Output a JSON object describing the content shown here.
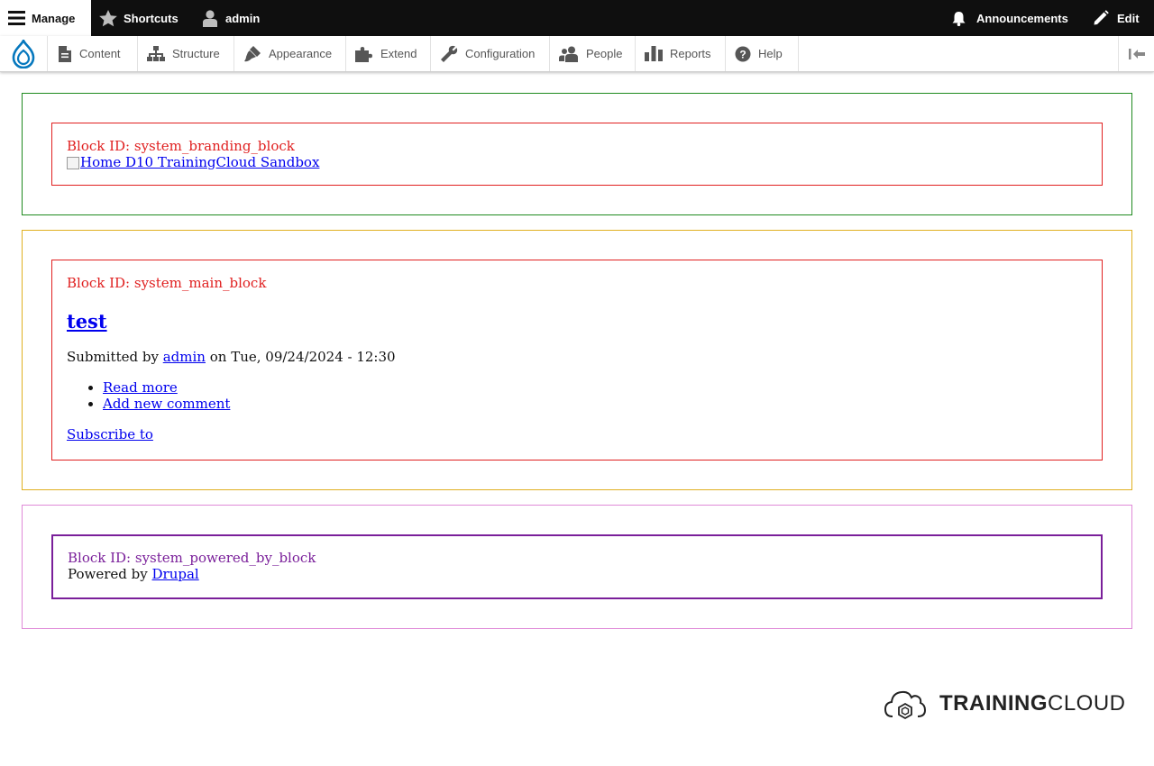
{
  "toolbar": {
    "manage_label": "Manage",
    "shortcuts_label": "Shortcuts",
    "user_label": "admin",
    "announcements_label": "Announcements",
    "edit_label": "Edit"
  },
  "tray": {
    "items": [
      {
        "label": "Content",
        "icon": "file-icon"
      },
      {
        "label": "Structure",
        "icon": "sitemap-icon"
      },
      {
        "label": "Appearance",
        "icon": "paintbrush-icon"
      },
      {
        "label": "Extend",
        "icon": "puzzle-icon"
      },
      {
        "label": "Configuration",
        "icon": "wrench-icon"
      },
      {
        "label": "People",
        "icon": "people-icon"
      },
      {
        "label": "Reports",
        "icon": "bar-chart-icon"
      },
      {
        "label": "Help",
        "icon": "help-icon"
      }
    ]
  },
  "colors": {
    "toolbar_bg": "#0f0f0f",
    "drupal_blue": "#0678be",
    "region_header": "#1e8a1e",
    "region_content": "#e0b020",
    "region_footer": "#e08ad8",
    "block_border": "#e02020",
    "powered_border": "#7a1f9a"
  },
  "regions": {
    "header": {
      "block_id": "Block ID: system_branding_block",
      "branding_alt": "Home D10 TrainingCloud Sandbox"
    },
    "content": {
      "block_id": "Block ID: system_main_block",
      "node_title": "test",
      "submitted_prefix": "Submitted by",
      "author": "admin",
      "submitted_date": "on Tue, 09/24/2024 - 12:30",
      "read_more": "Read more",
      "add_comment": "Add new comment",
      "subscribe": "Subscribe to"
    },
    "footer": {
      "block_id": "Block ID: system_powered_by_block",
      "powered_prefix": "Powered by",
      "powered_link": "Drupal"
    }
  },
  "branding": {
    "logo_word_bold": "TRAINING",
    "logo_word_light": "CLOUD"
  }
}
